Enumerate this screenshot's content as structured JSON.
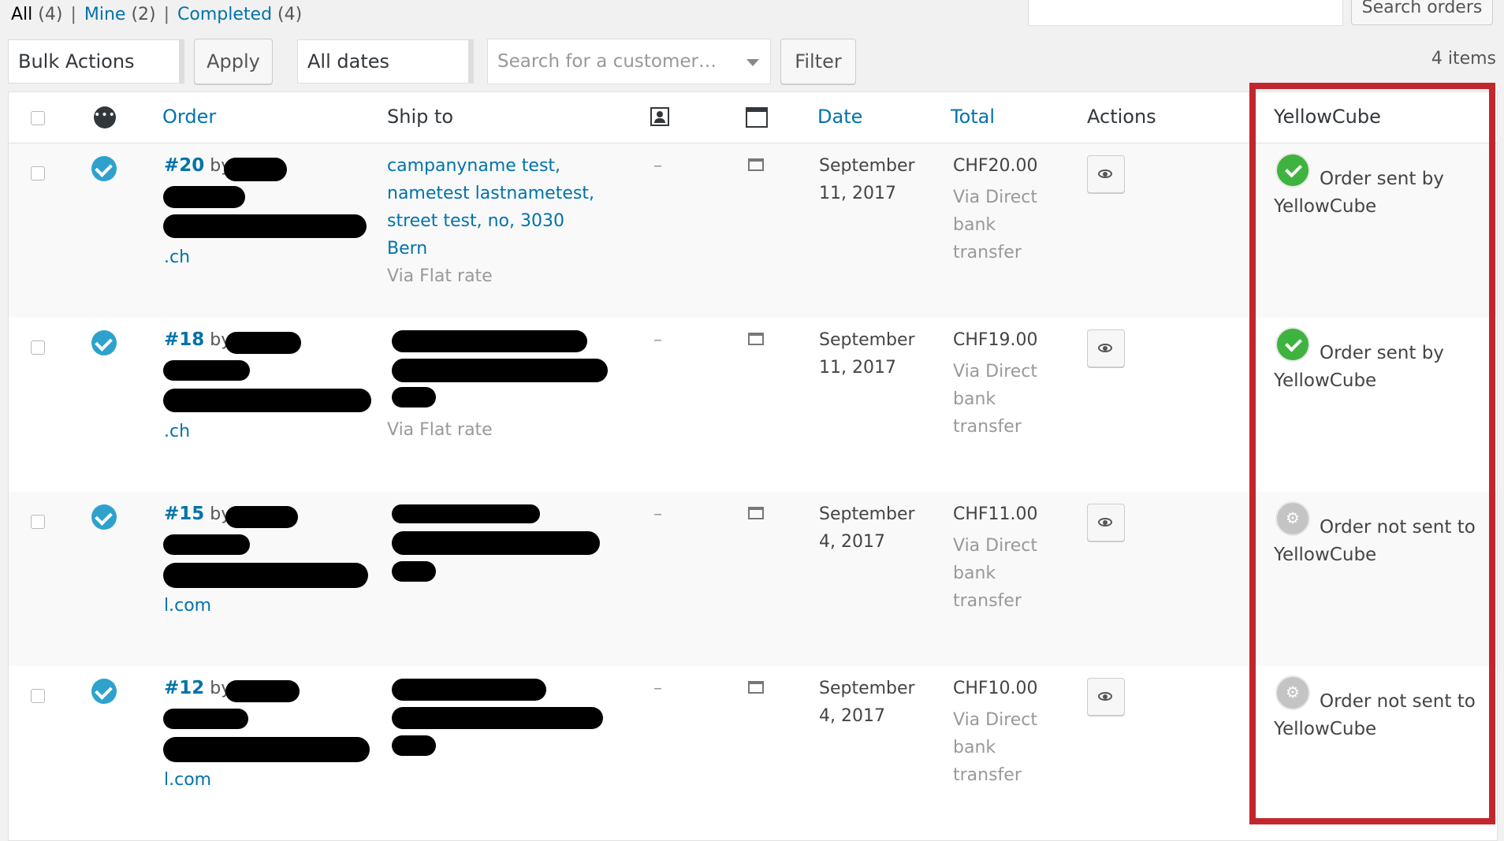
{
  "filters": {
    "all_label": "All",
    "all_count": "(4)",
    "mine_label": "Mine",
    "mine_count": "(2)",
    "completed_label": "Completed",
    "completed_count": "(4)",
    "separator": "|"
  },
  "search": {
    "value": "",
    "button_label": "Search orders"
  },
  "toolbar": {
    "bulk_actions": "Bulk Actions",
    "apply_label": "Apply",
    "dates": "All dates",
    "customer_placeholder": "Search for a customer…",
    "filter_label": "Filter",
    "items_count": "4 items"
  },
  "columns": {
    "order": "Order",
    "ship_to": "Ship to",
    "date": "Date",
    "total": "Total",
    "actions": "Actions",
    "yellowcube": "YellowCube"
  },
  "rows": [
    {
      "number": "#20",
      "by": "by",
      "email_tail": ".ch",
      "ship_lines": [
        "campanyname test,",
        "nametest lastnametest,",
        "street test, no, 3030",
        "Bern"
      ],
      "ship_via": "Via Flat rate",
      "dash": "–",
      "date_line1": "September",
      "date_line2": "11, 2017",
      "total": "CHF20.00",
      "pay1": "Via Direct",
      "pay2": "bank",
      "pay3": "transfer",
      "yc_status": "sent",
      "yc_line1": "Order sent by",
      "yc_line2": "YellowCube"
    },
    {
      "number": "#18",
      "by": "by",
      "email_tail": ".ch",
      "ship_via": "Via Flat rate",
      "dash": "–",
      "date_line1": "September",
      "date_line2": "11, 2017",
      "total": "CHF19.00",
      "pay1": "Via Direct",
      "pay2": "bank",
      "pay3": "transfer",
      "yc_status": "sent",
      "yc_line1": "Order sent by",
      "yc_line2": "YellowCube"
    },
    {
      "number": "#15",
      "by": "by",
      "email_tail": "l.com",
      "dash": "–",
      "date_line1": "September",
      "date_line2": "4, 2017",
      "total": "CHF11.00",
      "pay1": "Via Direct",
      "pay2": "bank",
      "pay3": "transfer",
      "yc_status": "not_sent",
      "yc_line1": "Order not sent to",
      "yc_line2": "YellowCube"
    },
    {
      "number": "#12",
      "by": "by",
      "email_tail": "l.com",
      "dash": "–",
      "date_line1": "September",
      "date_line2": "4, 2017",
      "total": "CHF10.00",
      "pay1": "Via Direct",
      "pay2": "bank",
      "pay3": "transfer",
      "yc_status": "not_sent",
      "yc_line1": "Order not sent to",
      "yc_line2": "YellowCube"
    }
  ],
  "colors": {
    "link": "#0073aa",
    "highlight": "#c1272d",
    "sent": "#3fb33f",
    "not_sent": "#c4c4c4"
  },
  "icons": [
    "check-circle-icon",
    "status-dots-icon",
    "billing-address-icon",
    "shipping-address-icon",
    "note-icon",
    "eye-icon",
    "yellowcube-sent-icon",
    "yellowcube-not-sent-icon"
  ]
}
